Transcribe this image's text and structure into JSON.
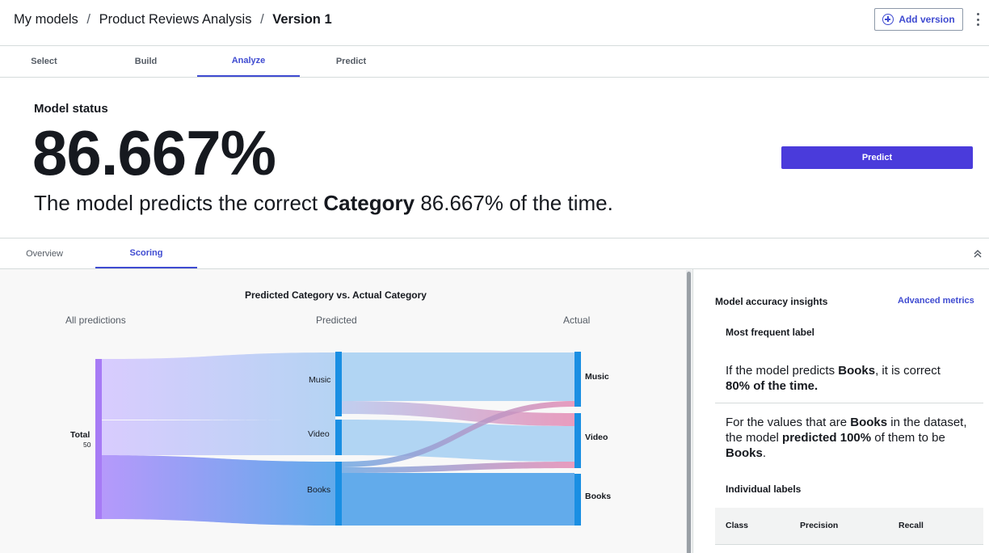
{
  "breadcrumb": {
    "items": [
      "My models",
      "Product Reviews Analysis"
    ],
    "current": "Version 1",
    "separator": "/"
  },
  "header": {
    "add_version_label": "Add version"
  },
  "steps": [
    "Select",
    "Build",
    "Analyze",
    "Predict"
  ],
  "active_step": "Analyze",
  "status": {
    "label": "Model status",
    "value": "86.667%",
    "statement_prefix": "The model predicts the correct",
    "statement_target": "Category",
    "statement_suffix": "86.667% of the time."
  },
  "predict_button_label": "Predict",
  "subtabs": [
    "Overview",
    "Scoring"
  ],
  "active_subtab": "Scoring",
  "chart": {
    "title": "Predicted Category vs. Actual Category",
    "columns": [
      "All predictions",
      "Predicted",
      "Actual"
    ],
    "total_label": "Total",
    "total_value": "50"
  },
  "chart_data": {
    "type": "sankey",
    "title": "Predicted Category vs. Actual Category",
    "columns": [
      "All predictions",
      "Predicted",
      "Actual"
    ],
    "nodes": {
      "source": [
        {
          "name": "Total",
          "value": 50
        }
      ],
      "predicted": [
        {
          "name": "Music",
          "value": 15
        },
        {
          "name": "Video",
          "value": 10
        },
        {
          "name": "Books",
          "value": 15
        }
      ],
      "actual": [
        {
          "name": "Music",
          "value": 14
        },
        {
          "name": "Video",
          "value": 14
        },
        {
          "name": "Books",
          "value": 14
        }
      ]
    },
    "links": [
      {
        "from": "Music",
        "to": "Music",
        "value": 13
      },
      {
        "from": "Music",
        "to": "Video",
        "value": 3
      },
      {
        "from": "Video",
        "to": "Video",
        "value": 10
      },
      {
        "from": "Books",
        "to": "Music",
        "value": 2
      },
      {
        "from": "Books",
        "to": "Video",
        "value": 1
      },
      {
        "from": "Books",
        "to": "Books",
        "value": 12
      }
    ],
    "colors": {
      "node": "#1a8fe3",
      "flow_start": "#c9b5ff",
      "flow_end": "#5aa7ea",
      "flow_correct": "#a9d0f2",
      "flow_incorrect": "#e58cb4"
    }
  },
  "insights": {
    "title": "Model accuracy insights",
    "advanced_metrics_label": "Advanced metrics",
    "most_frequent_label": "Most frequent label",
    "precision_text": {
      "prefix": "If the model predicts",
      "label": "Books",
      "mid": ", it is correct",
      "value": "80% of the time."
    },
    "recall_text": {
      "prefix": "For the values that are",
      "label": "Books",
      "mid": "in the dataset, the model",
      "value": "predicted 100%",
      "mid2": "of them to be",
      "label2": "Books",
      "suffix": "."
    },
    "individual_labels": "Individual labels",
    "table_headers": [
      "Class",
      "Precision",
      "Recall"
    ]
  }
}
